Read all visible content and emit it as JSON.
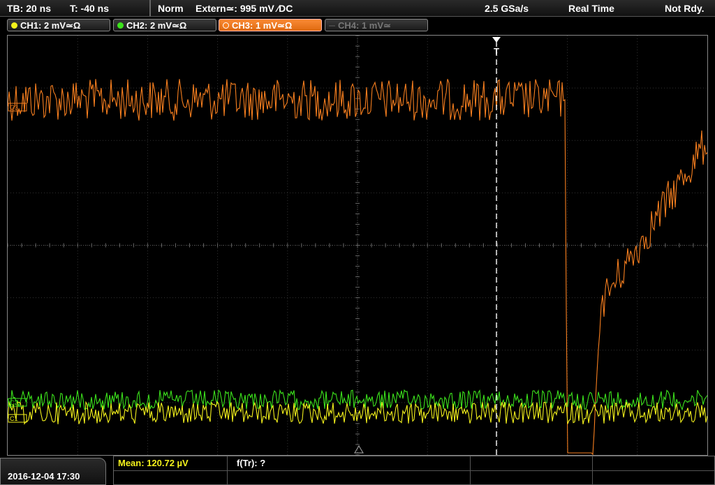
{
  "status": {
    "timebase": "TB: 20 ns",
    "trigger_offset": "T: -40 ns",
    "mode": "Norm",
    "trigger_source": "Extern≃: 995 mV ∕DC",
    "sample_rate": "2.5 GSa/s",
    "acq_mode": "Real Time",
    "state": "Not Rdy."
  },
  "channels": [
    {
      "label": "CH1: 2 mV≃Ω",
      "color": "#f4f21c",
      "active": true
    },
    {
      "label": "CH2: 2 mV≃Ω",
      "color": "#3ce21c",
      "active": true
    },
    {
      "label": "CH3: 1 mV≃Ω",
      "color": "#f77f1f",
      "active": true
    },
    {
      "label": "CH4: 1 mV≃",
      "color": "#888888",
      "active": false
    }
  ],
  "markers": {
    "ch3": "C3",
    "ch1": "C1",
    "ch2": "C2",
    "trigger": "T"
  },
  "footer": {
    "datetime": "2016-12-04 17:30",
    "mean": "Mean: 120.72 µV",
    "ftr": "f(Tr): ?"
  },
  "colors": {
    "ch1": "#f4f21c",
    "ch2": "#3ce21c",
    "ch3": "#f77f1f",
    "grid": "#3a3a3a"
  }
}
